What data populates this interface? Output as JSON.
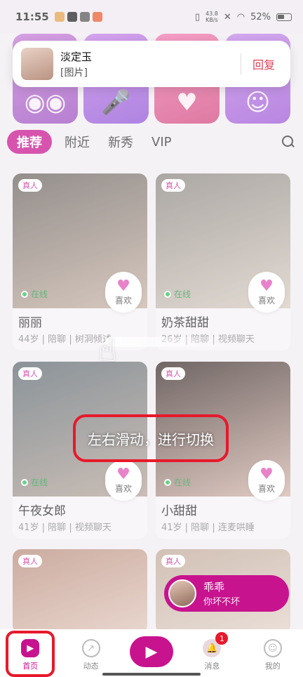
{
  "status_bar": {
    "time": "11:55",
    "speed_value": "43.8",
    "speed_unit": "KB/s",
    "battery": "52%",
    "app_dot_colors": [
      "#e2a14a",
      "#222222",
      "#555555",
      "#e85b2f"
    ]
  },
  "notification": {
    "sender": "淡定玉",
    "message": "[图片]",
    "reply_label": "回复"
  },
  "tabs": [
    {
      "label": "推荐",
      "active": true
    },
    {
      "label": "附近",
      "active": false
    },
    {
      "label": "新秀",
      "active": false
    },
    {
      "label": "VIP",
      "active": false
    }
  ],
  "cards": [
    {
      "badge": "真人",
      "online": "在线",
      "like_label": "喜欢",
      "name": "丽丽",
      "meta": "44岁 | 陪聊 | 树洞倾述",
      "photo_colors": [
        "#6b6460",
        "#c8b3a6"
      ]
    },
    {
      "badge": "真人",
      "online": "在线",
      "like_label": "喜欢",
      "name": "奶茶甜甜",
      "meta": "26岁 | 陪聊 | 视频聊天",
      "photo_colors": [
        "#8b8680",
        "#d8ccc2"
      ]
    },
    {
      "badge": "真人",
      "online": "在线",
      "like_label": "喜欢",
      "name": "午夜女郎",
      "meta": "41岁 | 陪聊 | 视频聊天",
      "photo_colors": [
        "#5e6a72",
        "#b6a59a"
      ]
    },
    {
      "badge": "真人",
      "online": "在线",
      "like_label": "喜欢",
      "name": "小甜甜",
      "meta": "41岁 | 陪聊 | 连麦哄睡",
      "photo_colors": [
        "#3a2c2a",
        "#d6b6ac"
      ]
    },
    {
      "badge": "真人",
      "online": "",
      "like_label": "",
      "name": "",
      "meta": "",
      "photo_colors": [
        "#b88c7c",
        "#f0ddd3"
      ]
    },
    {
      "badge": "真人",
      "online": "",
      "like_label": "",
      "name": "",
      "meta": "",
      "photo_colors": [
        "#c0a99a",
        "#efe2d9"
      ]
    }
  ],
  "hint": {
    "text": "左右滑动，进行切换"
  },
  "chat_float": {
    "name": "乖乖",
    "message": "你坏不坏"
  },
  "bottom_nav": [
    {
      "label": "首页",
      "icon": "play-icon",
      "active": true
    },
    {
      "label": "动态",
      "icon": "compass-icon",
      "active": false
    },
    {
      "label": "",
      "icon": "video-icon",
      "active": false
    },
    {
      "label": "消息",
      "icon": "bell-icon",
      "active": false,
      "unread": "1"
    },
    {
      "label": "我的",
      "icon": "profile-icon",
      "active": false
    }
  ]
}
